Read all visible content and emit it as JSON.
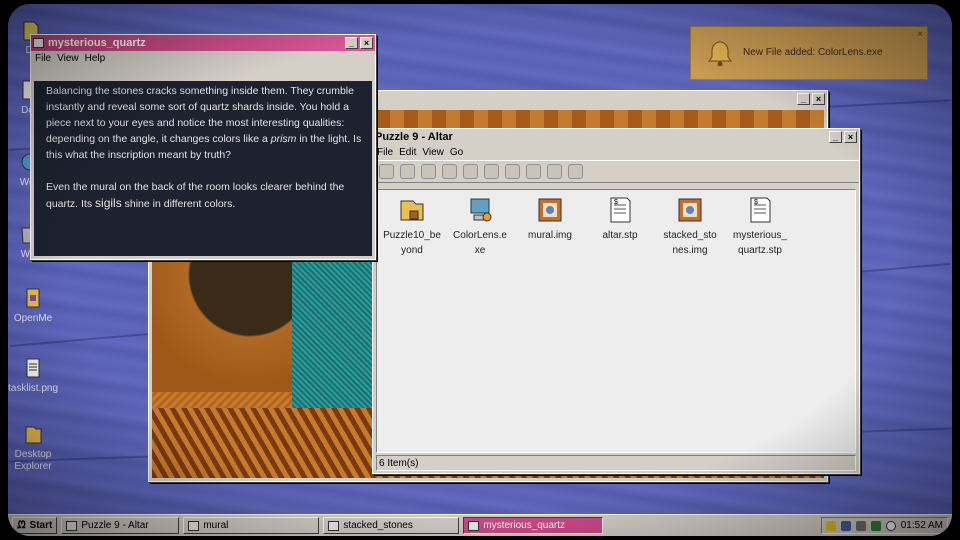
{
  "desktop_icons": [
    {
      "label": "Do",
      "icon": "folder-icon"
    },
    {
      "label": "Doc",
      "icon": "document-icon"
    },
    {
      "label": "Web",
      "icon": "globe-icon"
    },
    {
      "label": "Wa",
      "icon": "trash-icon"
    },
    {
      "label": "OpenMe",
      "icon": "script-icon"
    },
    {
      "label": "tasklist.png",
      "icon": "notepad-icon"
    },
    {
      "label": "Desktop Explorer",
      "icon": "explorer-icon"
    }
  ],
  "note_window": {
    "title": "mysterious_quartz",
    "menu": [
      "File",
      "View",
      "Help"
    ],
    "paragraph1_before": "Balancing the stones cracks something inside them. They crumble instantly and reveal some sort of quartz shards inside. You hold a piece next to your eyes and notice the most interesting qualities: depending on the angle, it changes colors like a ",
    "paragraph1_em": "prism",
    "paragraph1_after": " in the light. Is this what the inscription meant by truth?",
    "paragraph2_before": "Even the mural on the back of the room looks clearer behind the quartz. Its ",
    "paragraph2_em": "sigils",
    "paragraph2_after": " shine in different colors."
  },
  "explorer_window": {
    "title": "Puzzle 9 - Altar",
    "menu": [
      "File",
      "Edit",
      "View",
      "Go"
    ],
    "files": [
      {
        "name_line1": "Puzzle10_be",
        "name_line2": "yond",
        "icon": "locked-folder-icon"
      },
      {
        "name_line1": "ColorLens.e",
        "name_line2": "xe",
        "icon": "computer-app-icon"
      },
      {
        "name_line1": "mural.img",
        "name_line2": "",
        "icon": "image-icon"
      },
      {
        "name_line1": "altar.stp",
        "name_line2": "",
        "icon": "stp-document-icon"
      },
      {
        "name_line1": "stacked_sto",
        "name_line2": "nes.img",
        "icon": "image-icon"
      },
      {
        "name_line1": "mysterious_",
        "name_line2": "quartz.stp",
        "icon": "stp-document-icon"
      }
    ],
    "status": "6 Item(s)"
  },
  "notification": {
    "message": "New File added: ColorLens.exe",
    "close": "×"
  },
  "taskbar": {
    "start": "Start",
    "tasks": [
      {
        "label": "Puzzle 9 - Altar",
        "active": false
      },
      {
        "label": "mural",
        "active": false
      },
      {
        "label": "stacked_stones",
        "active": false
      },
      {
        "label": "mysterious_quartz",
        "active": true
      }
    ],
    "clock": "01:52 AM"
  },
  "colors": {
    "note_title_bar": "#c0407a",
    "note_body": "#1c2230",
    "desktop": "#5a62b8",
    "notification": "#c89a52"
  }
}
